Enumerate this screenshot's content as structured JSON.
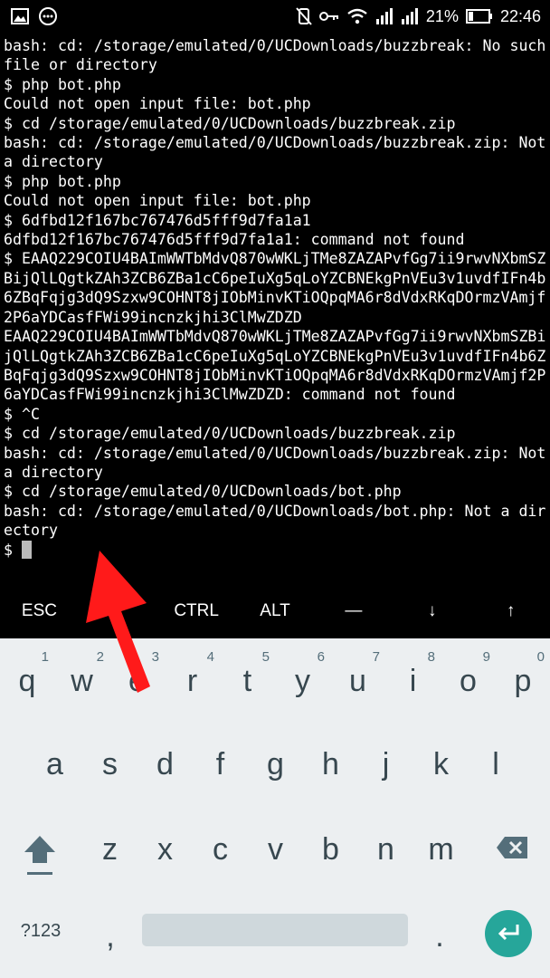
{
  "status_bar": {
    "icons_left": [
      "image-icon",
      "chat-icon"
    ],
    "icons_right": [
      "mute-icon",
      "key-icon",
      "wifi-icon",
      "signal-icon",
      "signal-icon",
      "battery-icon"
    ],
    "battery": "21%",
    "time": "22:46"
  },
  "terminal": {
    "lines": [
      "bash: cd: /storage/emulated/0/UCDownloads/buzzbreak: No such file or directory",
      "$ php bot.php",
      "Could not open input file: bot.php",
      "$ cd /storage/emulated/0/UCDownloads/buzzbreak.zip",
      "bash: cd: /storage/emulated/0/UCDownloads/buzzbreak.zip: Not a directory",
      "$ php bot.php",
      "Could not open input file: bot.php",
      "$ 6dfbd12f167bc767476d5fff9d7fa1a1",
      "6dfbd12f167bc767476d5fff9d7fa1a1: command not found",
      "$ EAAQ229COIU4BAImWWTbMdvQ870wWKLjTMe8ZAZAPvfGg7ii9rwvNXbmSZBijQlLQgtkZAh3ZCB6ZBa1cC6peIuXg5qLoYZCBNEkgPnVEu3v1uvdfIFn4b6ZBqFqjg3dQ9Szxw9COHNT8jIObMinvKTiOQpqMA6r8dVdxRKqDOrmzVAmjf2P6aYDCasfFWi99incnzkjhi3ClMwZDZD",
      "EAAQ229COIU4BAImWWTbMdvQ870wWKLjTMe8ZAZAPvfGg7ii9rwvNXbmSZBijQlLQgtkZAh3ZCB6ZBa1cC6peIuXg5qLoYZCBNEkgPnVEu3v1uvdfIFn4b6ZBqFqjg3dQ9Szxw9COHNT8jIObMinvKTiOQpqMA6r8dVdxRKqDOrmzVAmjf2P6aYDCasfFWi99incnzkjhi3ClMwZDZD: command not found",
      "$ ^C",
      "$ cd /storage/emulated/0/UCDownloads/buzzbreak.zip",
      "bash: cd: /storage/emulated/0/UCDownloads/buzzbreak.zip: Not a directory",
      "$ cd /storage/emulated/0/UCDownloads/bot.php",
      "bash: cd: /storage/emulated/0/UCDownloads/bot.php: Not a directory"
    ],
    "prompt": "$ "
  },
  "extra_keys": [
    "ESC",
    "",
    "CTRL",
    "ALT",
    "—",
    "↓",
    "↑"
  ],
  "keyboard": {
    "row1": [
      {
        "key": "q",
        "hint": "1"
      },
      {
        "key": "w",
        "hint": "2"
      },
      {
        "key": "e",
        "hint": "3"
      },
      {
        "key": "r",
        "hint": "4"
      },
      {
        "key": "t",
        "hint": "5"
      },
      {
        "key": "y",
        "hint": "6"
      },
      {
        "key": "u",
        "hint": "7"
      },
      {
        "key": "i",
        "hint": "8"
      },
      {
        "key": "o",
        "hint": "9"
      },
      {
        "key": "p",
        "hint": "0"
      }
    ],
    "row2": [
      "a",
      "s",
      "d",
      "f",
      "g",
      "h",
      "j",
      "k",
      "l"
    ],
    "row3": [
      "z",
      "x",
      "c",
      "v",
      "b",
      "n",
      "m"
    ],
    "symbols_label": "?123",
    "comma": ",",
    "period": ".",
    "accent_color": "#26a69a"
  },
  "annotation": {
    "color": "#ff1a1a"
  }
}
